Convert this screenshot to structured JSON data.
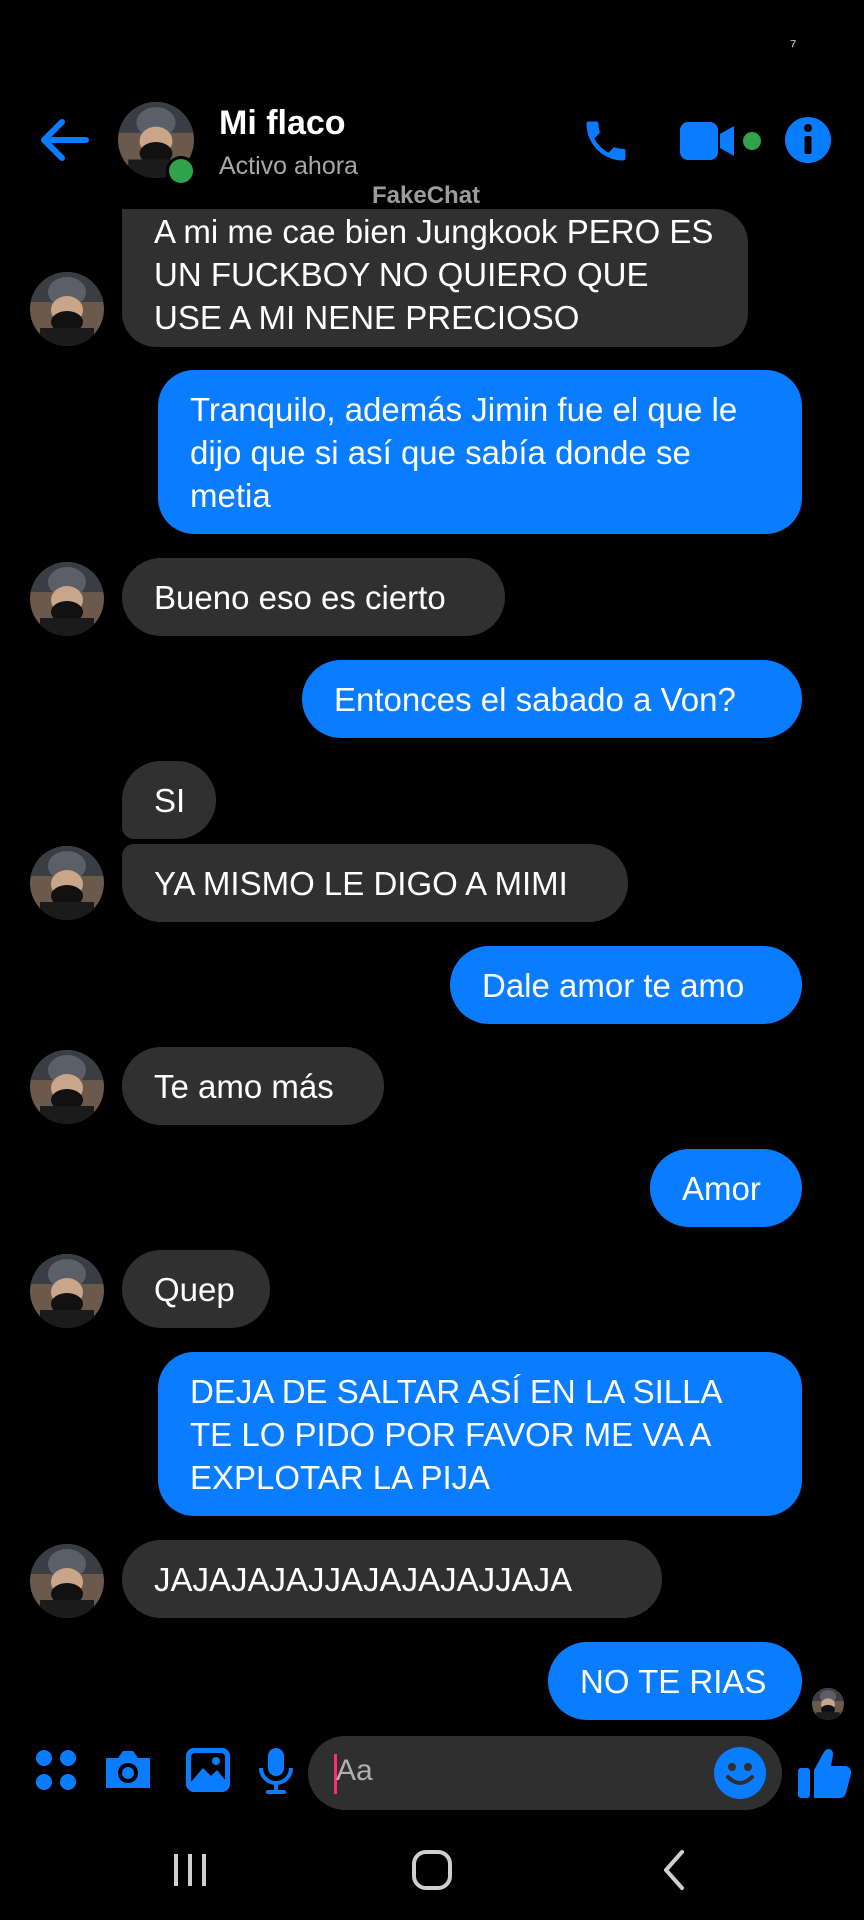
{
  "status_bar": {
    "indicator": "⁷"
  },
  "header": {
    "contact_name": "Mi flaco",
    "status": "Activo ahora",
    "watermark": "FakeChat",
    "icons": [
      "back-arrow-icon",
      "phone-icon",
      "video-camera-icon",
      "info-icon"
    ]
  },
  "messages": [
    {
      "side": "in",
      "text": "A mi me cae bien Jungkook PERO ES UN FUCKBOY NO QUIERO QUE USE A MI NENE PRECIOSO"
    },
    {
      "side": "out",
      "text": "Tranquilo, además Jimin fue el que le dijo que si así que sabía donde se metia"
    },
    {
      "side": "in",
      "text": "Bueno eso es cierto"
    },
    {
      "side": "out",
      "text": "Entonces el sabado a Von?"
    },
    {
      "side": "in",
      "text": "SI"
    },
    {
      "side": "in",
      "text": "YA MISMO LE DIGO A MIMI"
    },
    {
      "side": "out",
      "text": "Dale amor te amo"
    },
    {
      "side": "in",
      "text": "Te amo más"
    },
    {
      "side": "out",
      "text": "Amor"
    },
    {
      "side": "in",
      "text": "Quep"
    },
    {
      "side": "out",
      "text": "DEJA DE SALTAR ASÍ EN LA SILLA TE LO PIDO POR FAVOR ME VA A EXPLOTAR LA PIJA"
    },
    {
      "side": "in",
      "text": "JAJAJAJAJJAJAJAJAJJAJA"
    },
    {
      "side": "out",
      "text": "NO TE RIAS"
    }
  ],
  "composer": {
    "placeholder": "Aa",
    "icons": [
      "apps-icon",
      "camera-icon",
      "gallery-icon",
      "microphone-icon",
      "emoji-icon",
      "thumbs-up-icon"
    ]
  },
  "colors": {
    "accent": "#0a7cff",
    "incoming_bubble": "#303030",
    "background": "#000000",
    "online": "#31a24c"
  }
}
